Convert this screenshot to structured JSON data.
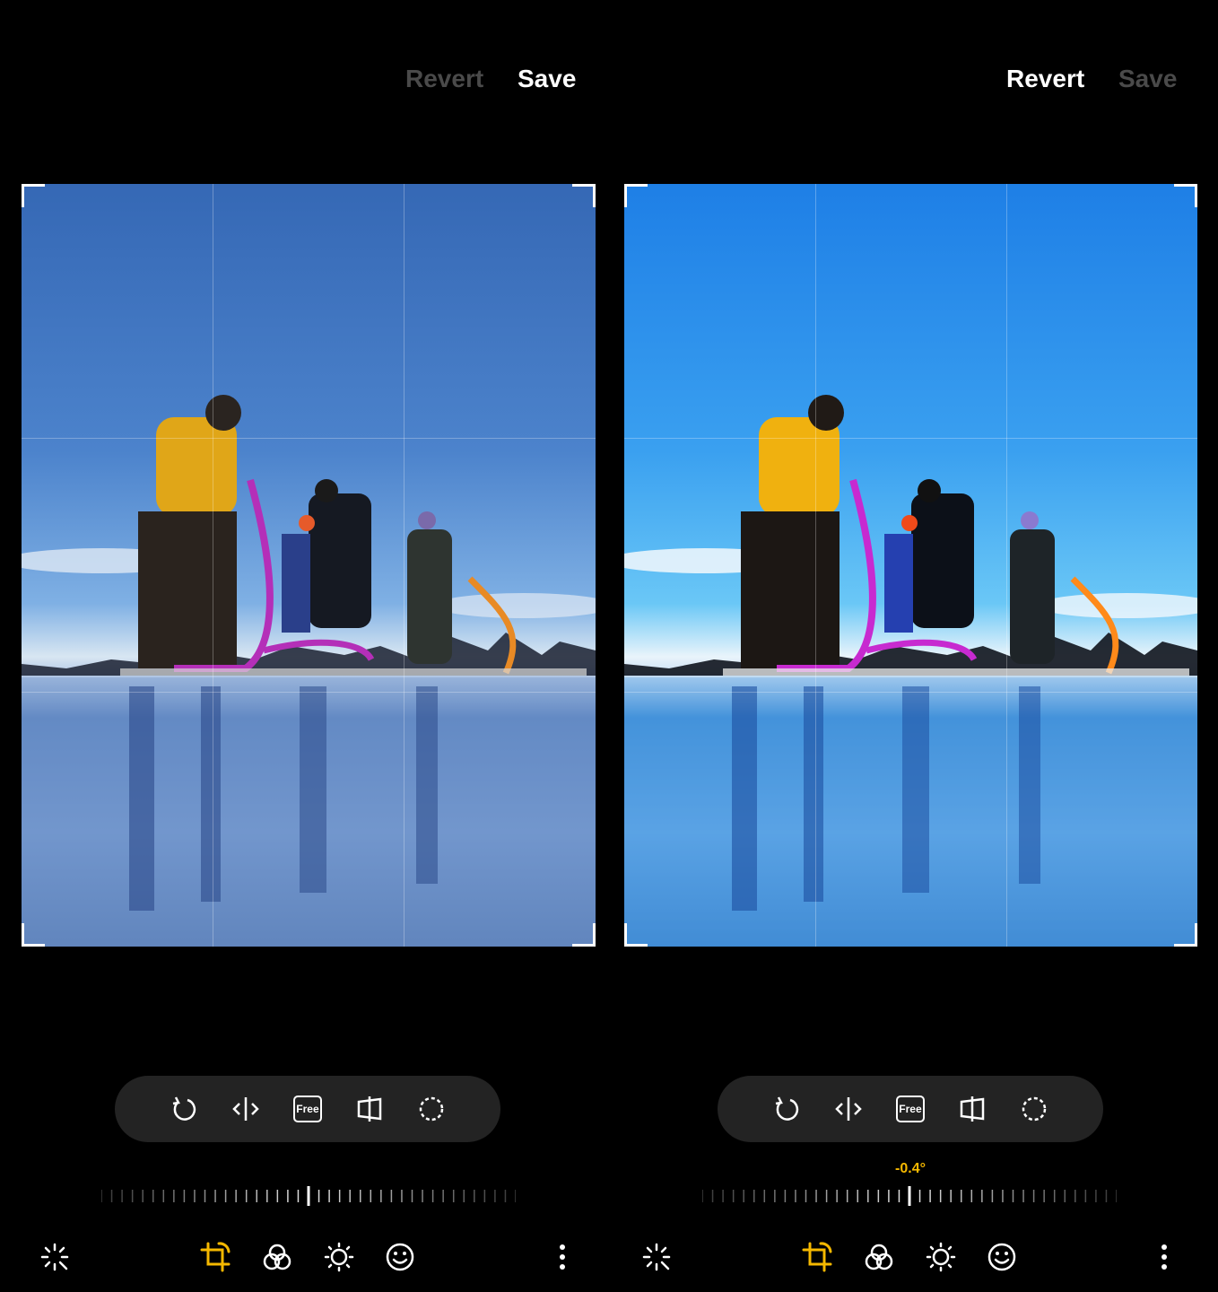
{
  "panels": [
    {
      "id": "before",
      "actions": {
        "revert": "Revert",
        "save": "Save",
        "revert_enabled": false,
        "save_enabled": true
      },
      "straighten_angle": "",
      "toolbar": {
        "free_label": "Free"
      },
      "photo_tone": "muted-blue"
    },
    {
      "id": "after",
      "actions": {
        "revert": "Revert",
        "save": "Save",
        "revert_enabled": true,
        "save_enabled": false
      },
      "straighten_angle": "-0.4°",
      "toolbar": {
        "free_label": "Free"
      },
      "photo_tone": "vivid-blue"
    }
  ],
  "toolbar_icons": [
    "rotate-icon",
    "flip-icon",
    "free-ratio-icon",
    "perspective-icon",
    "lasso-icon"
  ],
  "bottom_nav_icons": [
    "auto-enhance-icon",
    "crop-rotate-icon",
    "filters-icon",
    "brightness-icon",
    "sticker-icon",
    "more-icon"
  ],
  "colors": {
    "accent": "#f5b800",
    "toolbar_bg": "#232323",
    "disabled_text": "#4a4a4a"
  }
}
